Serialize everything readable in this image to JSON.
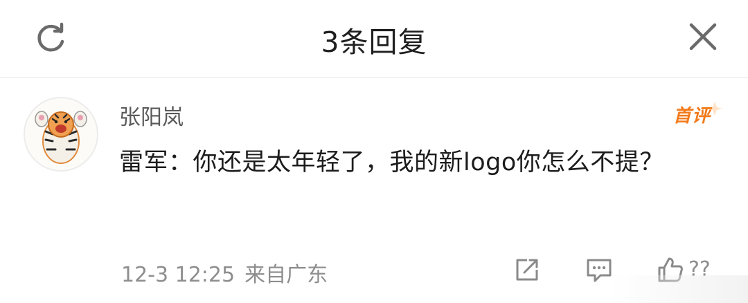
{
  "header": {
    "title": "3条回复",
    "refresh_icon": "refresh-icon",
    "close_icon": "close-icon"
  },
  "comment": {
    "username": "张阳岚",
    "badge": "首评",
    "text": "雷军：你还是太年轻了，我的新logo你怎么不提？",
    "timestamp": "12-3 12:25",
    "source": "来自广东",
    "like_count": "??",
    "actions": [
      "share-icon",
      "reply-icon",
      "like-icon"
    ]
  },
  "colors": {
    "badge": "#f27a1a",
    "meta_text": "#8e8e8e",
    "username": "#5a5a5a"
  }
}
